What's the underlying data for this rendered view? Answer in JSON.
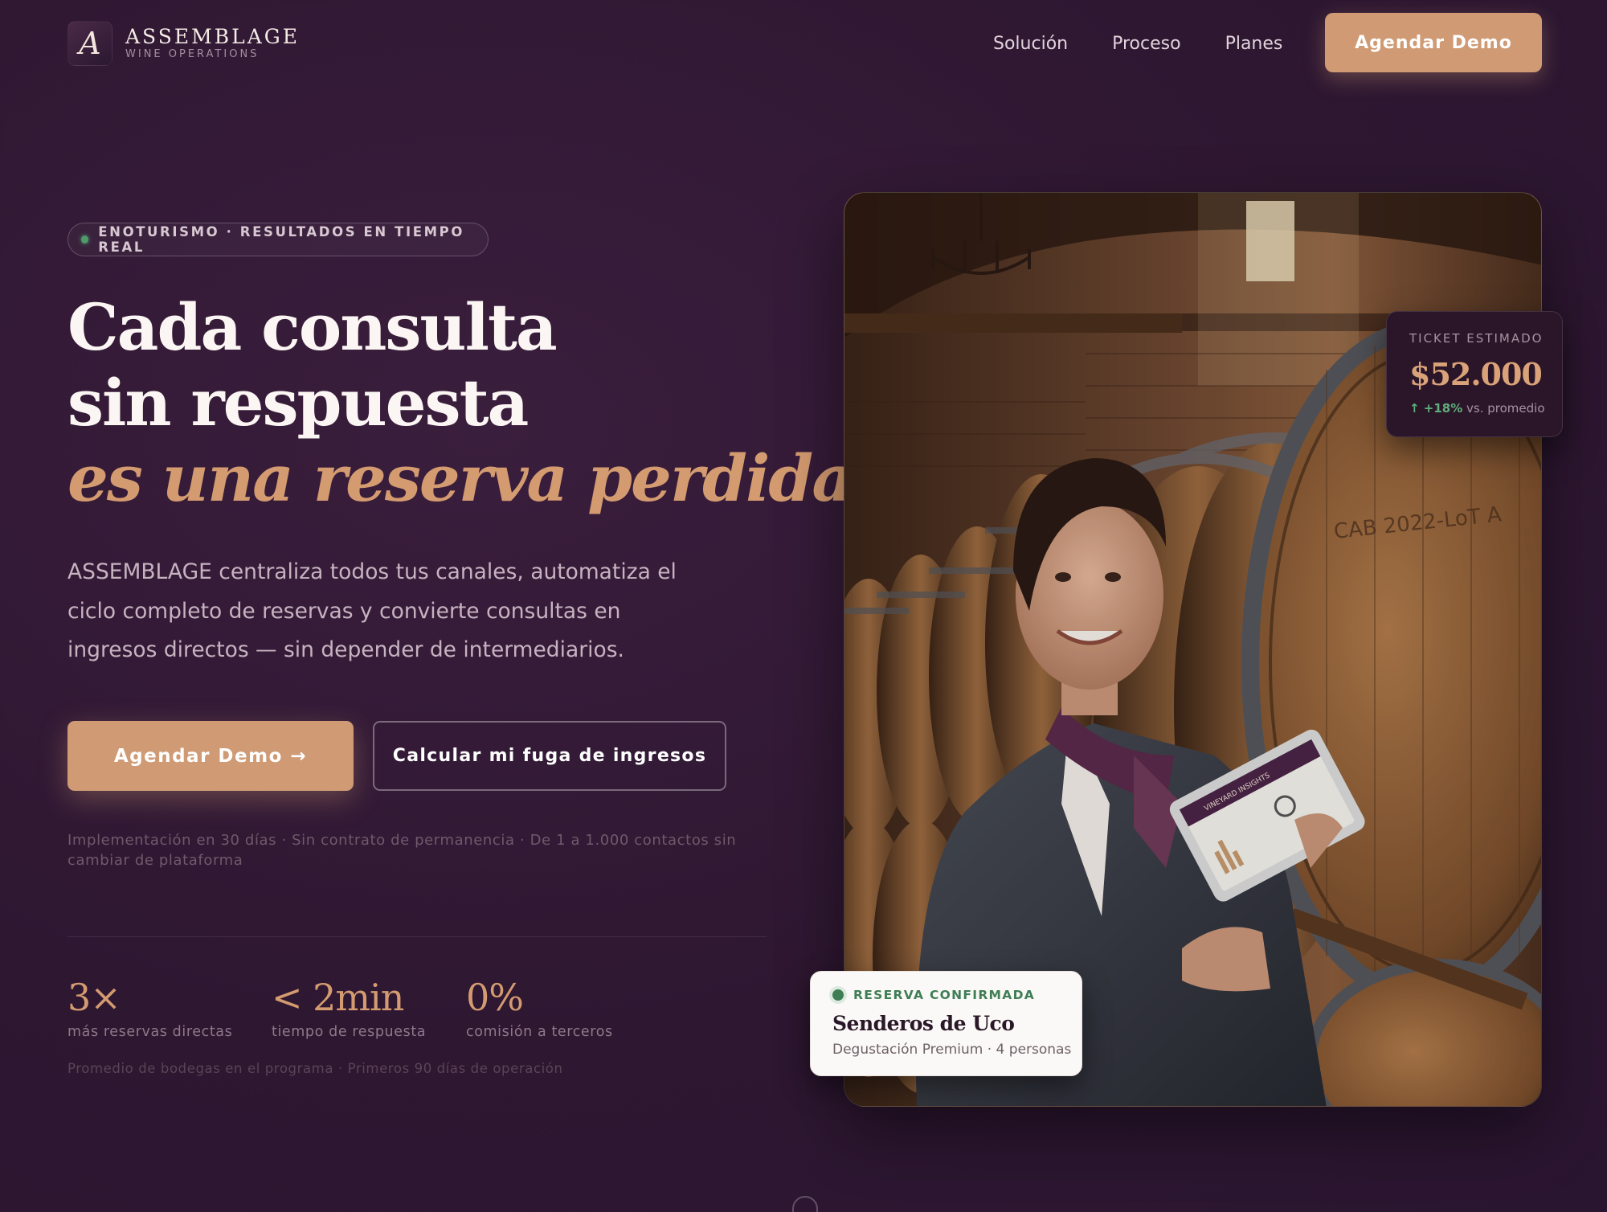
{
  "brand": {
    "name": "ASSEMBLAGE",
    "tagline": "WINE OPERATIONS",
    "mark": "A"
  },
  "nav": {
    "links": [
      "Solución",
      "Proceso",
      "Planes"
    ],
    "cta": "Agendar Demo"
  },
  "hero": {
    "badge": "ENOTURISMO · RESULTADOS EN TIEMPO REAL",
    "headline": [
      "Cada consulta",
      "sin respuesta",
      "es una reserva perdida."
    ],
    "lead": "ASSEMBLAGE centraliza todos tus canales, automatiza el ciclo completo de reservas y convierte consultas en ingresos directos — sin depender de intermediarios.",
    "primary_cta": "Agendar Demo →",
    "secondary_cta": "Calcular mi fuga de ingresos",
    "fine_print": "Implementación en 30 días · Sin contrato de permanencia · De 1 a 1.000 contactos sin cambiar de plataforma"
  },
  "stats": [
    {
      "value": "3×",
      "label": "más reservas directas"
    },
    {
      "value": "< 2min",
      "label": "tiempo de respuesta"
    },
    {
      "value": "0%",
      "label": "comisión a terceros"
    }
  ],
  "stats_note": "Promedio de bodegas en el programa · Primeros 90 días de operación",
  "ticket_card": {
    "label": "TICKET ESTIMADO",
    "value": "$52.000",
    "change": "↑ +18%",
    "change_note": "vs. promedio"
  },
  "reservation_card": {
    "status": "RESERVA CONFIRMADA",
    "title": "Senderos de Uco",
    "detail": "Degustación Premium · 4 personas"
  },
  "photo": {
    "barrel_text": "CAB 2022-LoT A",
    "tablet_title": "VINEYARD INSIGHTS"
  },
  "colors": {
    "accent": "#cf9a74",
    "background": "#2e1731",
    "success": "#3f7d55"
  }
}
